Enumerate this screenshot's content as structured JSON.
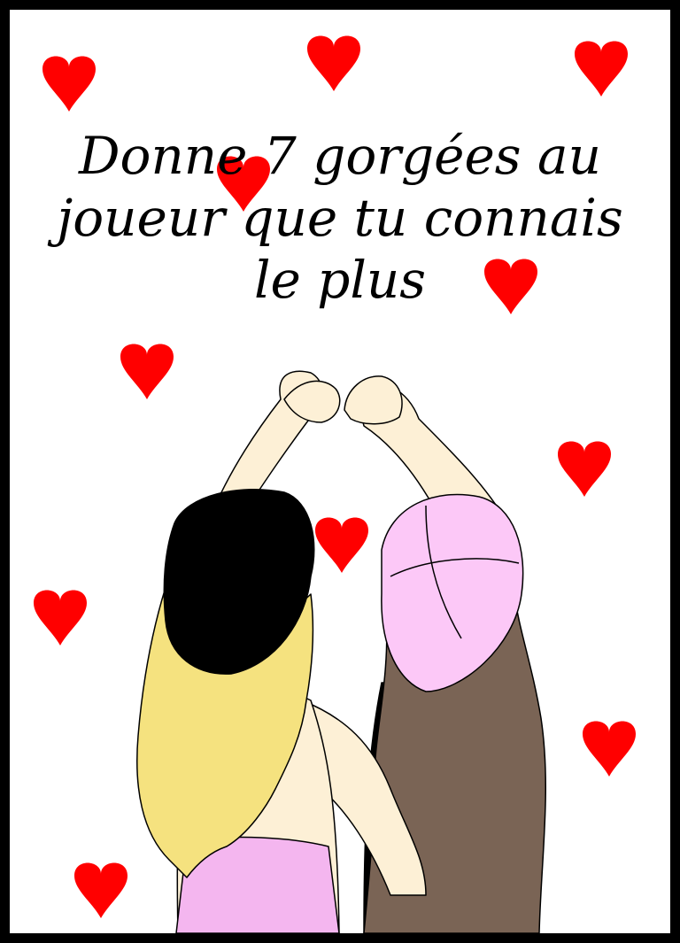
{
  "card": {
    "text_lines": [
      "Donne 7 gorgées au",
      "joueur que tu connais",
      "le plus"
    ]
  },
  "colors": {
    "border": "#000000",
    "background": "#ffffff",
    "heart": "#ff0000",
    "skin": "#fdf0d6",
    "blonde_hair": "#f5e27f",
    "brown_hair": "#7a6455",
    "pink_cap": "#fcc8f7",
    "black_cap": "#000000",
    "pink_top": "#f4b6ef",
    "black_top": "#000000"
  },
  "illustration": {
    "subject": "two-friends-making-heart-with-hands",
    "icons": [
      "heart-icon"
    ]
  }
}
